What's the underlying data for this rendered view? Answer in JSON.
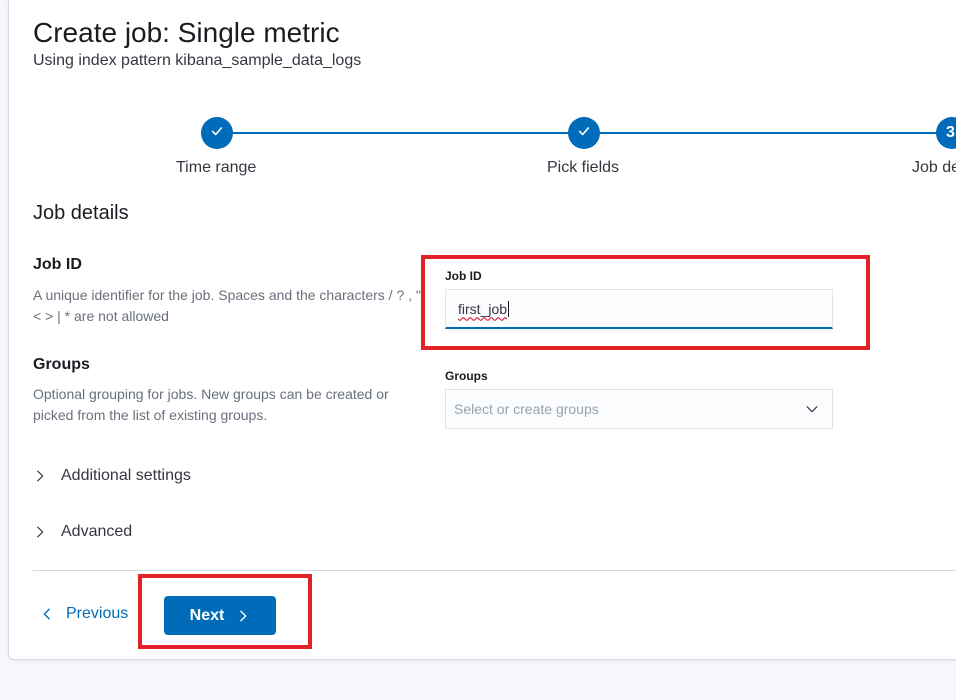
{
  "header": {
    "title": "Create job: Single metric",
    "subtitle": "Using index pattern kibana_sample_data_logs"
  },
  "steps": [
    {
      "title": "Time range",
      "status": "complete",
      "icon": "check-icon"
    },
    {
      "title": "Pick fields",
      "status": "complete",
      "icon": "check-icon"
    },
    {
      "title": "Job de",
      "number": "3",
      "status": "current"
    }
  ],
  "section": {
    "title": "Job details"
  },
  "job_id": {
    "title": "Job ID",
    "description": "A unique identifier for the job. Spaces and the characters / ? , \" < > | * are not allowed",
    "label": "Job ID",
    "value": "first_job"
  },
  "groups": {
    "title": "Groups",
    "description": "Optional grouping for jobs. New groups can be created or picked from the list of existing groups.",
    "label": "Groups",
    "placeholder": "Select or create groups"
  },
  "accordions": {
    "additional": "Additional settings",
    "advanced": "Advanced"
  },
  "footer": {
    "previous_label": "Previous",
    "next_label": "Next"
  },
  "colors": {
    "accent": "#006bb8",
    "highlight": "#e32227"
  }
}
